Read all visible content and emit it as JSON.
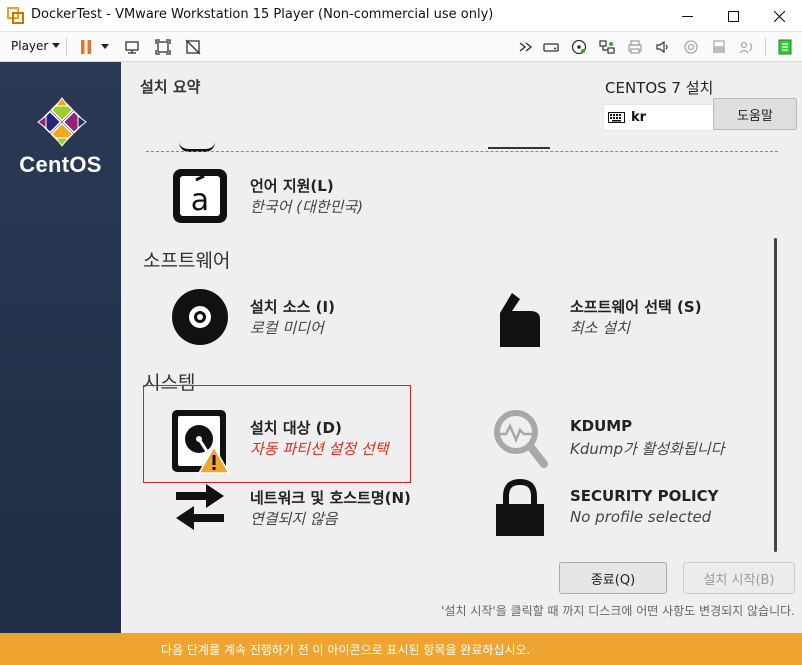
{
  "window": {
    "title": "DockerTest - VMware Workstation 15 Player (Non-commercial use only)"
  },
  "toolbar": {
    "player_label": "Player"
  },
  "sidebar": {
    "logo_text": "CentOS"
  },
  "header": {
    "summary_title": "설치 요약",
    "install_title": "CENTOS 7 설치",
    "keyboard_layout": "kr",
    "help_button": "도움말"
  },
  "sections": {
    "software": "소프트웨어",
    "system": "시스템"
  },
  "spokes": {
    "language": {
      "title": "언어 지원(L)",
      "status": "한국어 (대한민국)"
    },
    "install_source": {
      "title": "설치 소스 (I)",
      "status": "로컬 미디어"
    },
    "software_selection": {
      "title": "소프트웨어 선택 (S)",
      "status": "최소 설치"
    },
    "install_destination": {
      "title": "설치 대상 (D)",
      "status": "자동 파티션 설정 선택"
    },
    "kdump": {
      "title": "KDUMP",
      "status": "Kdump가 활성화됩니다"
    },
    "network": {
      "title": "네트워크 및 호스트명(N)",
      "status": "연결되지 않음"
    },
    "security": {
      "title": "SECURITY POLICY",
      "status": "No profile selected"
    }
  },
  "buttons": {
    "quit": "종료(Q)",
    "begin_install": "설치 시작(B)"
  },
  "hint_text": "'설치 시작'을 클릭할 때 까지 디스크에 어떤 사항도 변경되지 않습니다.",
  "warning_bar": {
    "text": "다음 단계를 계속 진행하기 전 이 아이콘으로 표시된 항목을 완료하십시오."
  },
  "colors": {
    "warning": "#f0a430",
    "error_text": "#e02b1e",
    "sidebar": "#23324a"
  }
}
